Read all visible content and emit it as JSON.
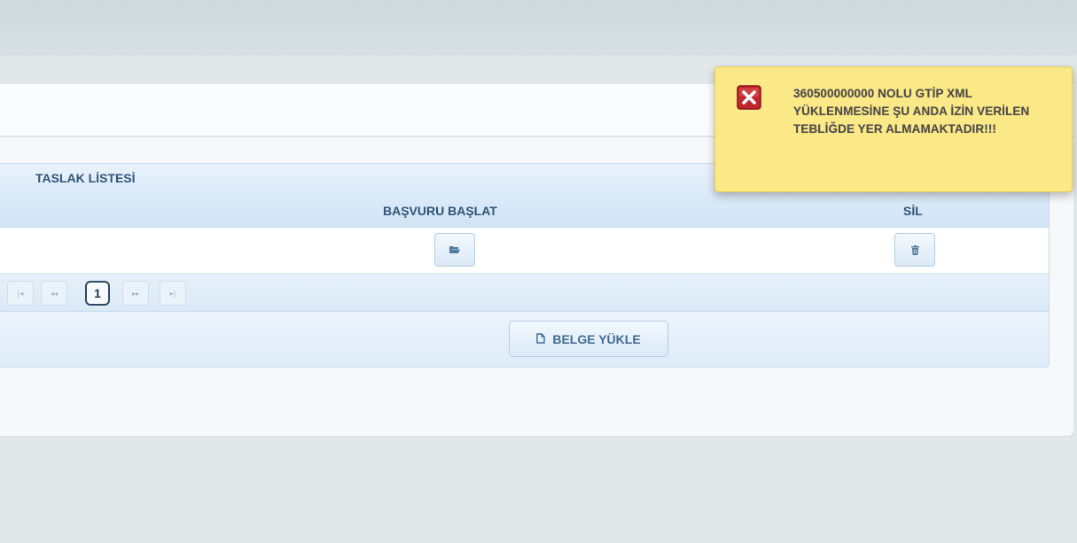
{
  "panel": {
    "title": "TASLAK LİSTESİ",
    "columns": {
      "start_application": "BAŞVURU BAŞLAT",
      "delete": "SİL"
    }
  },
  "row_actions": {
    "open_icon": "folder-open-icon",
    "delete_icon": "trash-icon"
  },
  "pager": {
    "first": "|◂",
    "prev": "◂◂",
    "current_page": "1",
    "next": "▸▸",
    "last": "▸|"
  },
  "footer": {
    "upload_label": "BELGE YÜKLE",
    "upload_icon": "document-icon"
  },
  "toast": {
    "type": "error",
    "icon": "close-box-icon",
    "message": "360500000000 NOLU GTİP XML YÜKLENMESİNE ŞU ANDA İZİN VERİLEN TEBLİĞDE YER ALMAMAKTADIR!!!",
    "background_color": "#fbe887",
    "icon_color": "#c0262c"
  },
  "colors": {
    "panel_header_text": "#2f5478",
    "button_text": "#3d6a92"
  }
}
